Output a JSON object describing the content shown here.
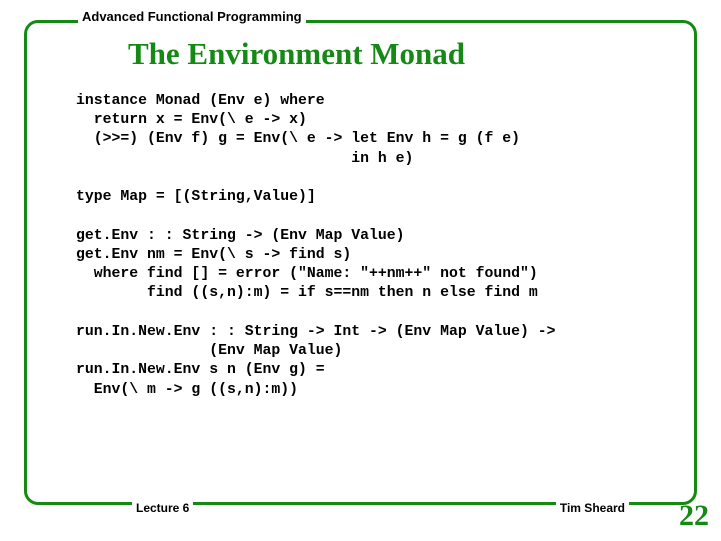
{
  "header": {
    "course": "Advanced Functional Programming",
    "title": "The Environment Monad"
  },
  "code": {
    "lines": "instance Monad (Env e) where\n  return x = Env(\\ e -> x)\n  (>>=) (Env f) g = Env(\\ e -> let Env h = g (f e)\n                               in h e)\n\ntype Map = [(String,Value)]\n\nget.Env : : String -> (Env Map Value)\nget.Env nm = Env(\\ s -> find s)\n  where find [] = error (\"Name: \"++nm++\" not found\")\n        find ((s,n):m) = if s==nm then n else find m\n\nrun.In.New.Env : : String -> Int -> (Env Map Value) ->\n               (Env Map Value)\nrun.In.New.Env s n (Env g) =\n  Env(\\ m -> g ((s,n):m))"
  },
  "footer": {
    "lecture": "Lecture 6",
    "author": "Tim Sheard",
    "page": "22"
  }
}
